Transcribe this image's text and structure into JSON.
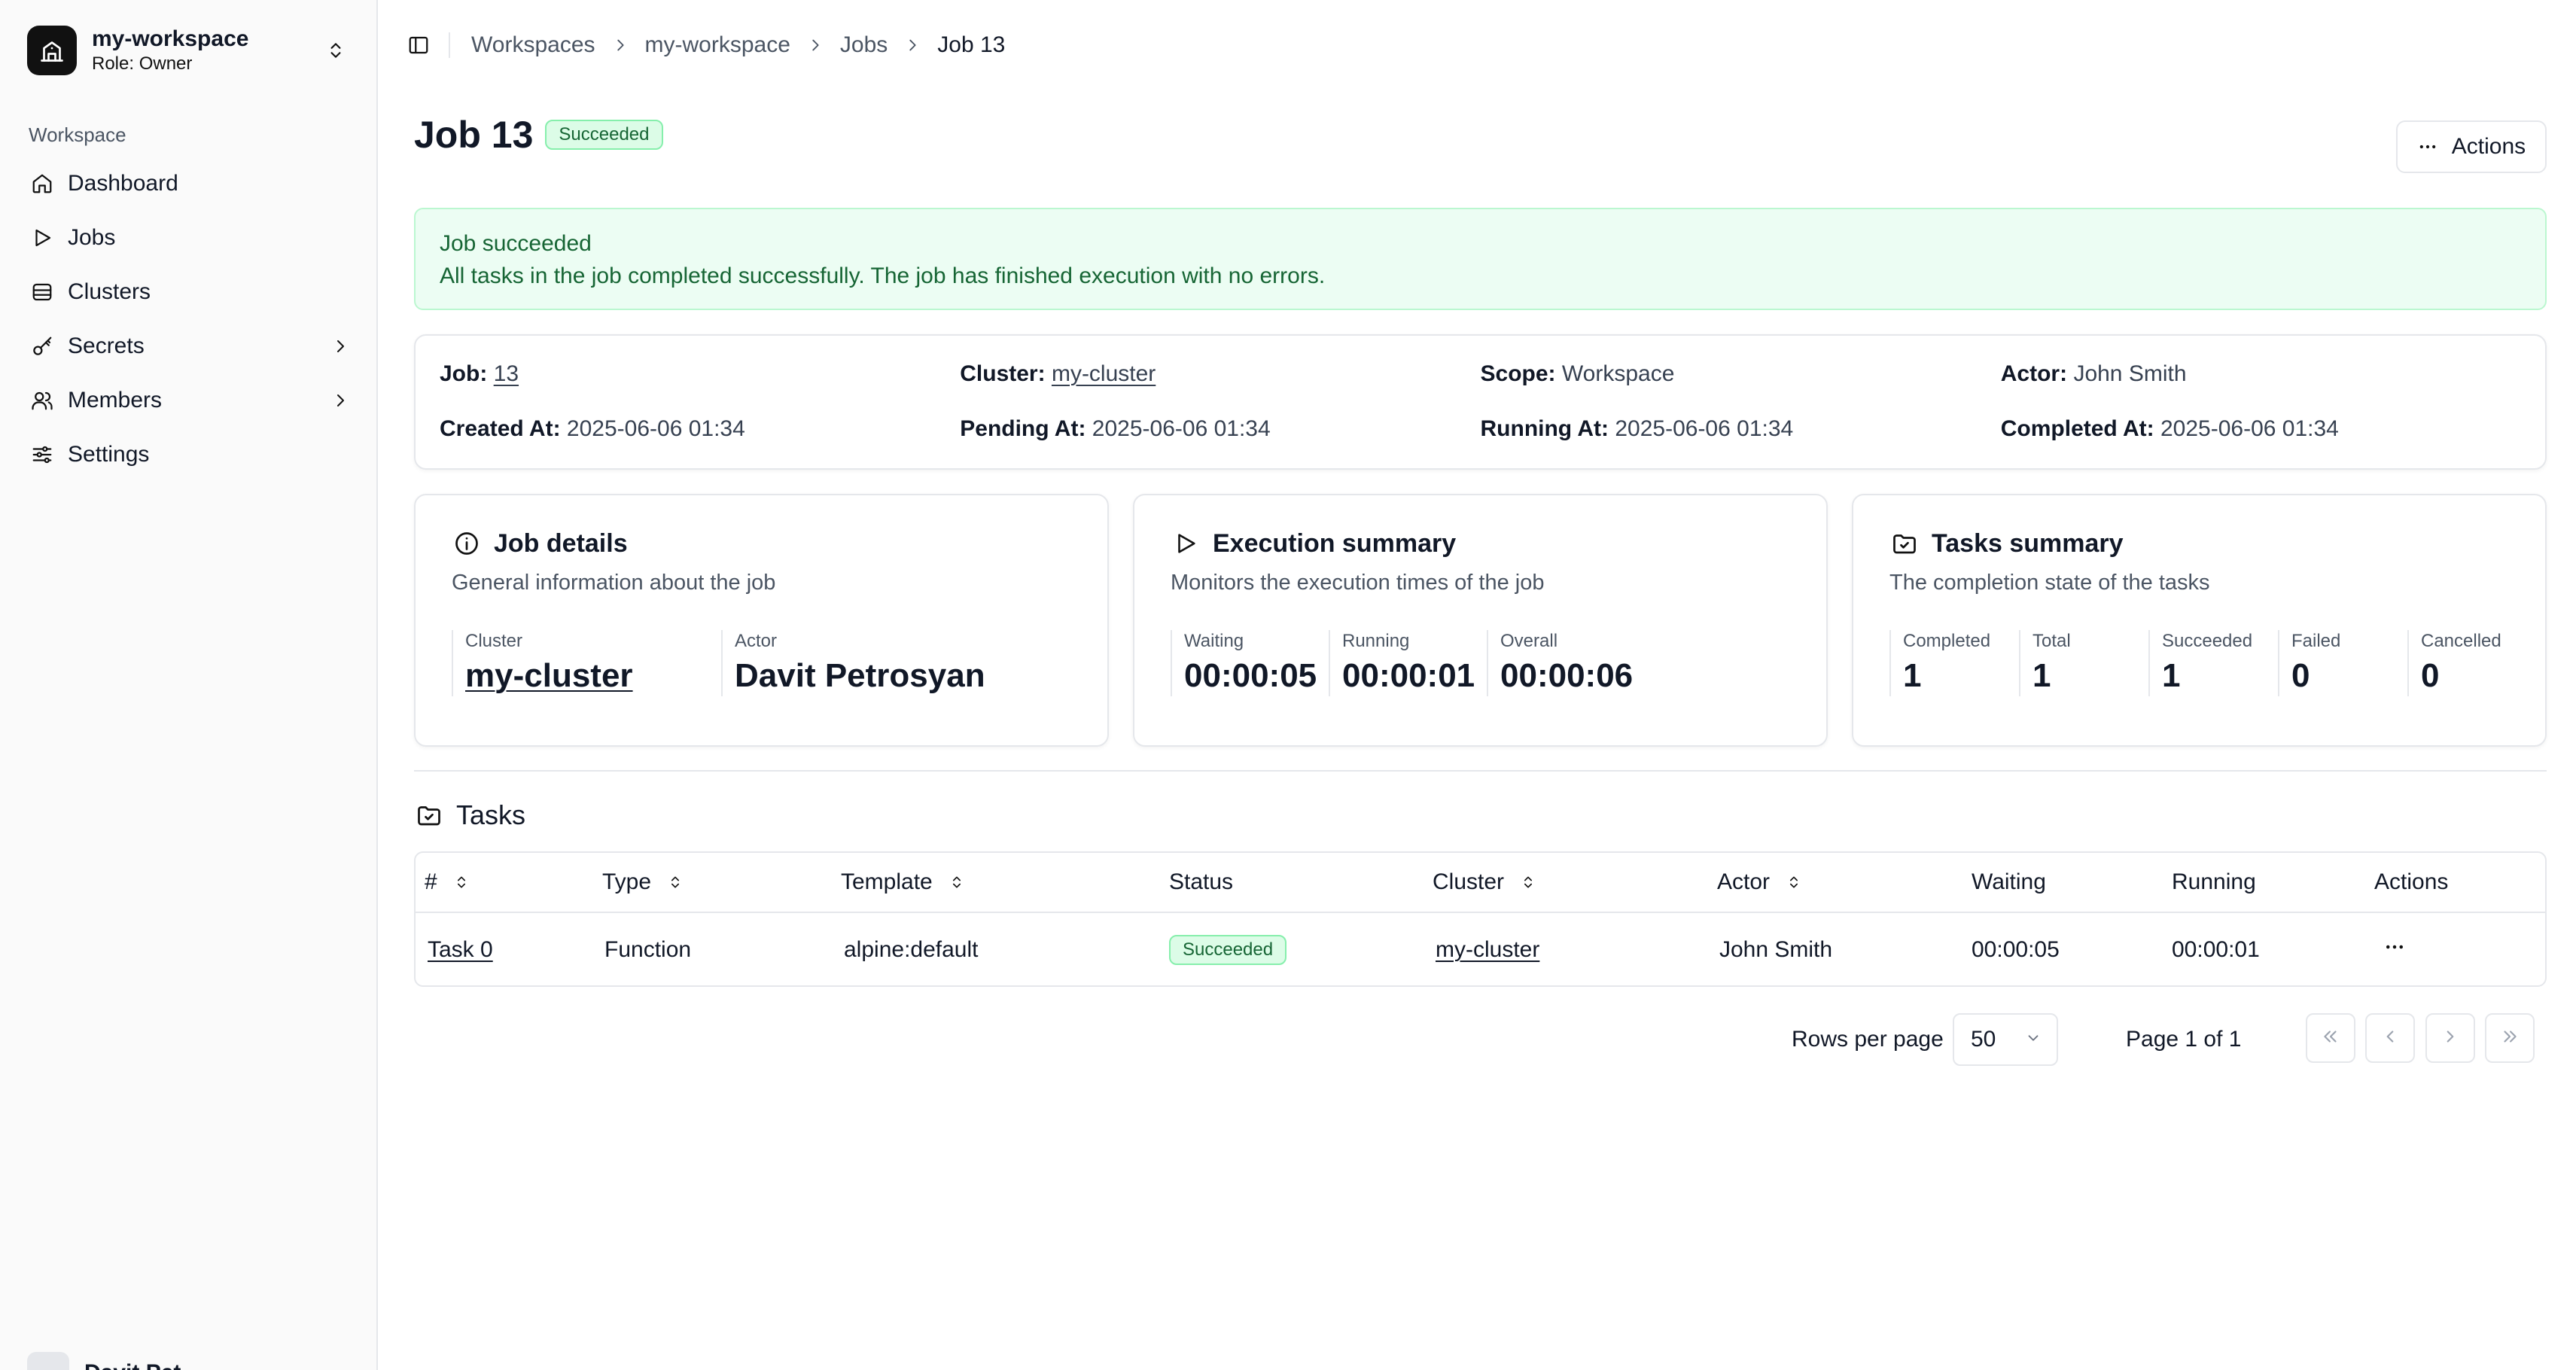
{
  "sidebar": {
    "workspace_name": "my-workspace",
    "workspace_role": "Role: Owner",
    "section_label": "Workspace",
    "items": [
      {
        "label": "Dashboard",
        "icon": "home-icon"
      },
      {
        "label": "Jobs",
        "icon": "play-icon"
      },
      {
        "label": "Clusters",
        "icon": "database-icon"
      },
      {
        "label": "Secrets",
        "icon": "key-icon",
        "has_submenu": true
      },
      {
        "label": "Members",
        "icon": "users-icon",
        "has_submenu": true
      },
      {
        "label": "Settings",
        "icon": "sliders-icon"
      }
    ],
    "user_name_partial": "Davit Pet"
  },
  "breadcrumb": [
    "Workspaces",
    "my-workspace",
    "Jobs",
    "Job 13"
  ],
  "page": {
    "title": "Job 13",
    "status": "Succeeded",
    "actions_label": "Actions"
  },
  "alert": {
    "title": "Job succeeded",
    "description": "All tasks in the job completed successfully. The job has finished execution with no errors."
  },
  "meta": {
    "job_label": "Job:",
    "job_value": "13",
    "cluster_label": "Cluster:",
    "cluster_value": "my-cluster",
    "scope_label": "Scope:",
    "scope_value": "Workspace",
    "actor_label": "Actor:",
    "actor_value": "John Smith",
    "created_label": "Created At:",
    "created_value": "2025-06-06 01:34",
    "pending_label": "Pending At:",
    "pending_value": "2025-06-06 01:34",
    "running_label": "Running At:",
    "running_value": "2025-06-06 01:34",
    "completed_label": "Completed At:",
    "completed_value": "2025-06-06 01:34"
  },
  "cards": {
    "details": {
      "title": "Job details",
      "subtitle": "General information about the job",
      "cluster_label": "Cluster",
      "cluster_value": "my-cluster",
      "actor_label": "Actor",
      "actor_value": "Davit Petrosyan"
    },
    "execution": {
      "title": "Execution summary",
      "subtitle": "Monitors the execution times of the job",
      "waiting_label": "Waiting",
      "waiting_value": "00:00:05",
      "running_label": "Running",
      "running_value": "00:00:01",
      "overall_label": "Overall",
      "overall_value": "00:00:06"
    },
    "tasks": {
      "title": "Tasks summary",
      "subtitle": "The completion state of the tasks",
      "completed_label": "Completed",
      "completed_value": "1",
      "total_label": "Total",
      "total_value": "1",
      "succeeded_label": "Succeeded",
      "succeeded_value": "1",
      "failed_label": "Failed",
      "failed_value": "0",
      "cancelled_label": "Cancelled",
      "cancelled_value": "0"
    }
  },
  "tasks_section": {
    "title": "Tasks",
    "columns": [
      "#",
      "Type",
      "Template",
      "Status",
      "Cluster",
      "Actor",
      "Waiting",
      "Running",
      "Actions"
    ],
    "rows": [
      {
        "name": "Task 0",
        "type": "Function",
        "template": "alpine:default",
        "status": "Succeeded",
        "cluster": "my-cluster",
        "actor": "John Smith",
        "waiting": "00:00:05",
        "running": "00:00:01"
      }
    ]
  },
  "pagination": {
    "rows_per_page_label": "Rows per page",
    "rows_per_page_value": "50",
    "page_text": "Page 1 of 1"
  },
  "colors": {
    "success_bg": "#ecfdf3",
    "success_text": "#166534",
    "border": "#e5e7eb"
  }
}
